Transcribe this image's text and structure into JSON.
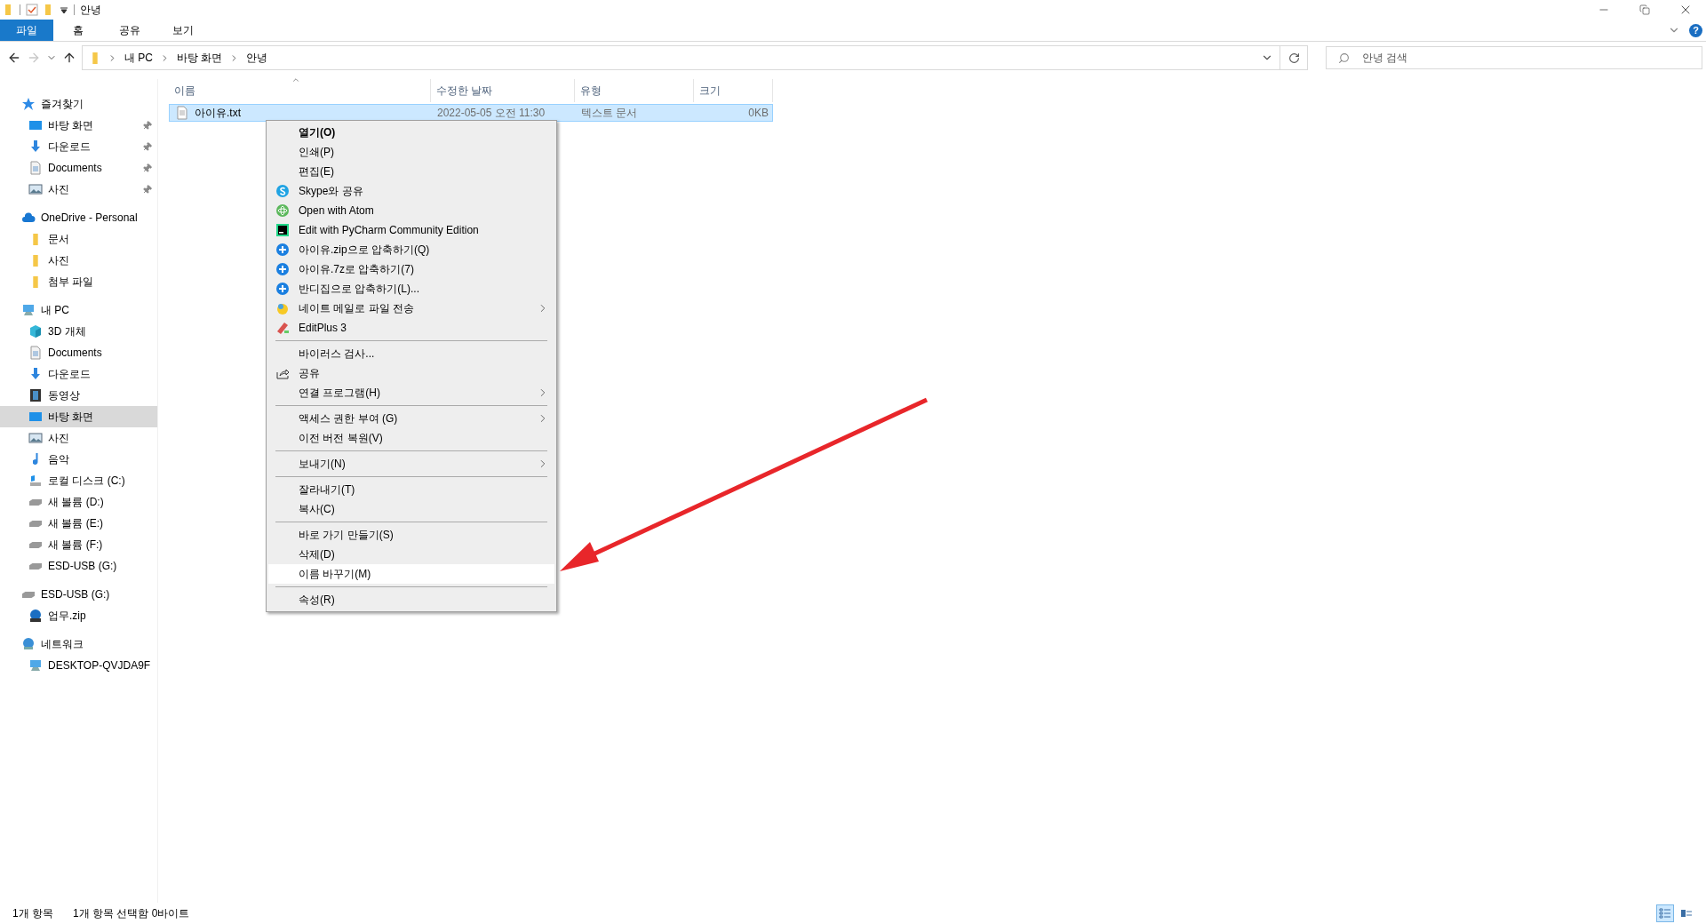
{
  "title_bar": {
    "title": "안녕"
  },
  "ribbon": {
    "tabs": [
      {
        "label": "파일",
        "selected": true
      },
      {
        "label": "홈",
        "selected": false
      },
      {
        "label": "공유",
        "selected": false
      },
      {
        "label": "보기",
        "selected": false
      }
    ],
    "help": "?"
  },
  "address_bar": {
    "crumbs": [
      "내 PC",
      "바탕 화면",
      "안녕"
    ],
    "forward_disabled": true
  },
  "search": {
    "placeholder": "안녕 검색"
  },
  "sidebar": {
    "sections": [
      {
        "label": "즐겨찾기",
        "kind": "star",
        "items": [
          {
            "label": "바탕 화면",
            "kind": "desktop",
            "pinned": true,
            "selected": false
          },
          {
            "label": "다운로드",
            "kind": "download",
            "pinned": true,
            "selected": false
          },
          {
            "label": "Documents",
            "kind": "document",
            "pinned": true,
            "selected": false
          },
          {
            "label": "사진",
            "kind": "pictures",
            "pinned": true,
            "selected": false
          }
        ]
      },
      {
        "label": "OneDrive - Personal",
        "kind": "cloud",
        "items": [
          {
            "label": "문서",
            "kind": "folder",
            "pinned": false,
            "selected": false
          },
          {
            "label": "사진",
            "kind": "folder",
            "pinned": false,
            "selected": false
          },
          {
            "label": "첨부 파일",
            "kind": "folder",
            "pinned": false,
            "selected": false
          }
        ]
      },
      {
        "label": "내 PC",
        "kind": "pc",
        "items": [
          {
            "label": "3D 개체",
            "kind": "cube",
            "pinned": false,
            "selected": false
          },
          {
            "label": "Documents",
            "kind": "document",
            "pinned": false,
            "selected": false
          },
          {
            "label": "다운로드",
            "kind": "download",
            "pinned": false,
            "selected": false
          },
          {
            "label": "동영상",
            "kind": "video",
            "pinned": false,
            "selected": false
          },
          {
            "label": "바탕 화면",
            "kind": "desktop",
            "pinned": false,
            "selected": true
          },
          {
            "label": "사진",
            "kind": "pictures",
            "pinned": false,
            "selected": false
          },
          {
            "label": "음악",
            "kind": "music",
            "pinned": false,
            "selected": false
          },
          {
            "label": "로컬 디스크 (C:)",
            "kind": "system-drive",
            "pinned": false,
            "selected": false
          },
          {
            "label": "새 볼륨 (D:)",
            "kind": "drive",
            "pinned": false,
            "selected": false
          },
          {
            "label": "새 볼륨 (E:)",
            "kind": "drive",
            "pinned": false,
            "selected": false
          },
          {
            "label": "새 볼륨 (F:)",
            "kind": "drive",
            "pinned": false,
            "selected": false
          },
          {
            "label": "ESD-USB (G:)",
            "kind": "drive",
            "pinned": false,
            "selected": false
          }
        ]
      },
      {
        "label": "ESD-USB (G:)",
        "kind": "drive",
        "items": [
          {
            "label": "업무.zip",
            "kind": "zip",
            "pinned": false,
            "selected": false
          }
        ]
      },
      {
        "label": "네트워크",
        "kind": "network",
        "items": [
          {
            "label": "DESKTOP-QVJDA9F",
            "kind": "pc",
            "pinned": false,
            "selected": false
          }
        ]
      }
    ]
  },
  "file_list": {
    "columns": [
      "이름",
      "수정한 날짜",
      "유형",
      "크기"
    ],
    "rows": [
      {
        "name": "아이유.txt",
        "modified": "2022-05-05 오전 11:30",
        "type": "텍스트 문서",
        "size": "0KB",
        "selected": true
      }
    ]
  },
  "context_menu": {
    "groups": [
      [
        {
          "label": "열기(O)",
          "kind": "plain",
          "default": true,
          "submenu": false,
          "highlighted": false
        },
        {
          "label": "인쇄(P)",
          "kind": "plain",
          "default": false,
          "submenu": false,
          "highlighted": false
        },
        {
          "label": "편집(E)",
          "kind": "plain",
          "default": false,
          "submenu": false,
          "highlighted": false
        },
        {
          "label": "Skype와 공유",
          "kind": "skype",
          "default": false,
          "submenu": false,
          "highlighted": false
        },
        {
          "label": "Open with Atom",
          "kind": "atom",
          "default": false,
          "submenu": false,
          "highlighted": false
        },
        {
          "label": "Edit with PyCharm Community Edition",
          "kind": "pycharm",
          "default": false,
          "submenu": false,
          "highlighted": false
        },
        {
          "label": "아이유.zip으로 압축하기(Q)",
          "kind": "bandizip",
          "default": false,
          "submenu": false,
          "highlighted": false
        },
        {
          "label": "아이유.7z로 압축하기(7)",
          "kind": "bandizip",
          "default": false,
          "submenu": false,
          "highlighted": false
        },
        {
          "label": "반디집으로 압축하기(L)...",
          "kind": "bandizip",
          "default": false,
          "submenu": false,
          "highlighted": false
        },
        {
          "label": "네이트 메일로 파일 전송",
          "kind": "nate",
          "default": false,
          "submenu": true,
          "highlighted": false
        },
        {
          "label": "EditPlus 3",
          "kind": "editplus",
          "default": false,
          "submenu": false,
          "highlighted": false
        }
      ],
      [
        {
          "label": "바이러스 검사...",
          "kind": "plain",
          "default": false,
          "submenu": false,
          "highlighted": false
        },
        {
          "label": "공유",
          "kind": "share",
          "default": false,
          "submenu": false,
          "highlighted": false
        },
        {
          "label": "연결 프로그램(H)",
          "kind": "plain",
          "default": false,
          "submenu": true,
          "highlighted": false
        }
      ],
      [
        {
          "label": "액세스 권한 부여 (G)",
          "kind": "plain",
          "default": false,
          "submenu": true,
          "highlighted": false
        },
        {
          "label": "이전 버전 복원(V)",
          "kind": "plain",
          "default": false,
          "submenu": false,
          "highlighted": false
        }
      ],
      [
        {
          "label": "보내기(N)",
          "kind": "plain",
          "default": false,
          "submenu": true,
          "highlighted": false
        }
      ],
      [
        {
          "label": "잘라내기(T)",
          "kind": "plain",
          "default": false,
          "submenu": false,
          "highlighted": false
        },
        {
          "label": "복사(C)",
          "kind": "plain",
          "default": false,
          "submenu": false,
          "highlighted": false
        }
      ],
      [
        {
          "label": "바로 가기 만들기(S)",
          "kind": "plain",
          "default": false,
          "submenu": false,
          "highlighted": false
        },
        {
          "label": "삭제(D)",
          "kind": "plain",
          "default": false,
          "submenu": false,
          "highlighted": false
        },
        {
          "label": "이름 바꾸기(M)",
          "kind": "plain",
          "default": false,
          "submenu": false,
          "highlighted": true
        }
      ],
      [
        {
          "label": "속성(R)",
          "kind": "plain",
          "default": false,
          "submenu": false,
          "highlighted": false
        }
      ]
    ]
  },
  "status_bar": {
    "items": [
      "1개 항목",
      "1개 항목 선택함 0바이트"
    ],
    "views": [
      {
        "kind": "details",
        "selected": true
      },
      {
        "kind": "tiles",
        "selected": false
      }
    ]
  }
}
